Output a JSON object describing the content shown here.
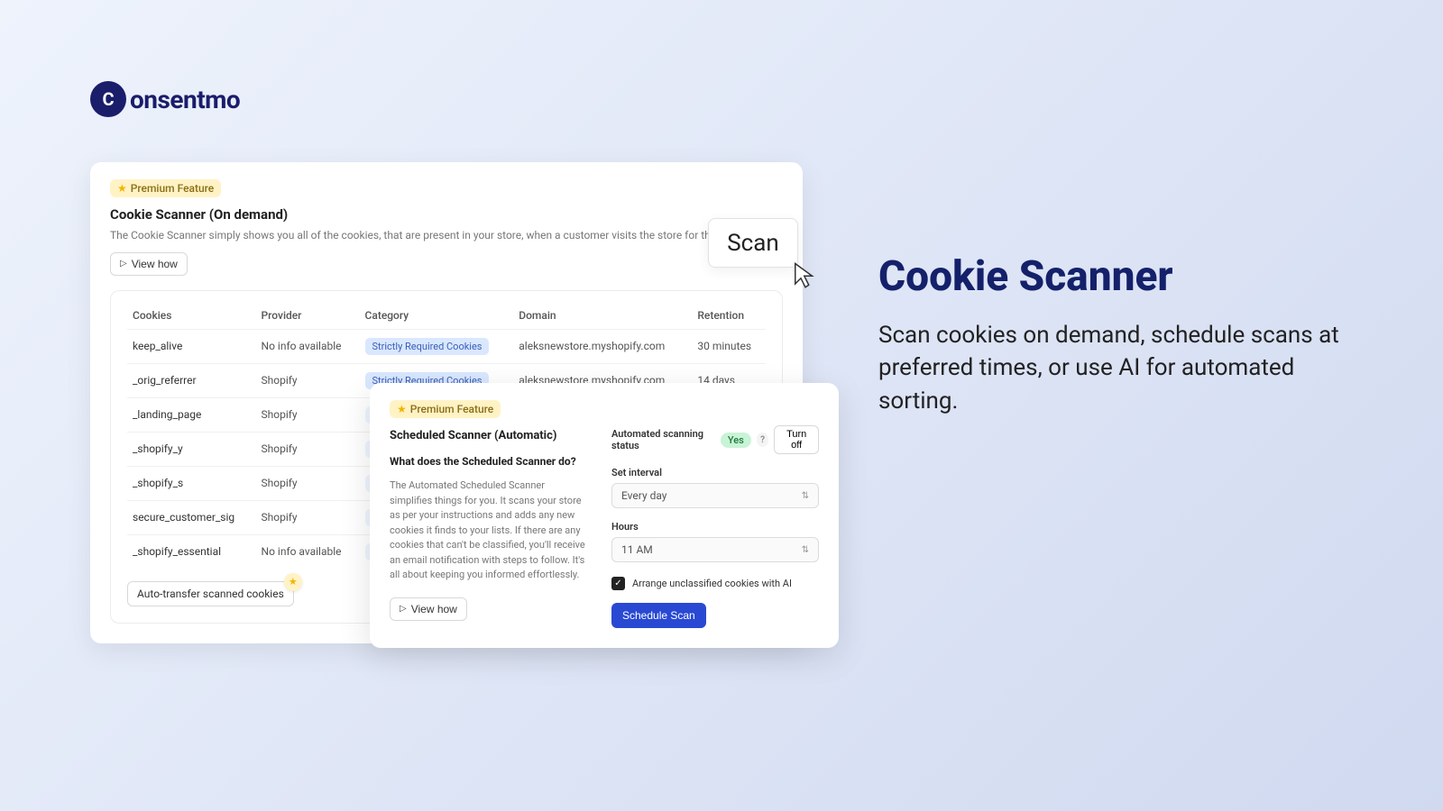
{
  "brand": {
    "name": "onsentmo",
    "initial": "C"
  },
  "hero": {
    "title": "Cookie Scanner",
    "subtitle": "Scan cookies on demand, schedule scans at preferred times, or use AI for automated sorting."
  },
  "card1": {
    "premium": "Premium Feature",
    "title": "Cookie Scanner (On demand)",
    "desc": "The Cookie Scanner simply shows you all of the cookies, that are present in your store, when a customer visits the store for the first time.",
    "viewHow": "View how",
    "scan": "Scan",
    "autoTransfer": "Auto-transfer scanned cookies",
    "columns": [
      "Cookies",
      "Provider",
      "Category",
      "Domain",
      "Retention"
    ],
    "rows": [
      {
        "cookie": "keep_alive",
        "provider": "No info available",
        "category": "Strictly Required Cookies",
        "domain": "aleksnewstore.myshopify.com",
        "retention": "30 minutes",
        "faint": false
      },
      {
        "cookie": "_orig_referrer",
        "provider": "Shopify",
        "category": "Strictly Required Cookies",
        "domain": "aleksnewstore.myshopify.com",
        "retention": "14 days",
        "faint": false
      },
      {
        "cookie": "_landing_page",
        "provider": "Shopify",
        "category": "",
        "domain": "",
        "retention": "",
        "faint": true
      },
      {
        "cookie": "_shopify_y",
        "provider": "Shopify",
        "category": "",
        "domain": "",
        "retention": "",
        "faint": true
      },
      {
        "cookie": "_shopify_s",
        "provider": "Shopify",
        "category": "",
        "domain": "",
        "retention": "",
        "faint": true
      },
      {
        "cookie": "secure_customer_sig",
        "provider": "Shopify",
        "category": "",
        "domain": "",
        "retention": "",
        "faint": true
      },
      {
        "cookie": "_shopify_essential",
        "provider": "No info available",
        "category": "",
        "domain": "",
        "retention": "",
        "faint": true
      }
    ]
  },
  "card2": {
    "premium": "Premium Feature",
    "title": "Scheduled Scanner (Automatic)",
    "question": "What does the Scheduled Scanner do?",
    "body": "The Automated Scheduled Scanner simplifies things for you. It scans your store as per your instructions and adds any new cookies it finds to your lists. If there are any cookies that can't be classified, you'll receive an email notification with steps to follow. It's all about keeping you informed effortlessly.",
    "viewHow": "View how",
    "statusLabel": "Automated scanning status",
    "statusValue": "Yes",
    "turnOff": "Turn off",
    "intervalLabel": "Set interval",
    "intervalValue": "Every day",
    "hoursLabel": "Hours",
    "hoursValue": "11 AM",
    "aiLabel": "Arrange unclassified cookies with AI",
    "scheduleBtn": "Schedule Scan"
  }
}
